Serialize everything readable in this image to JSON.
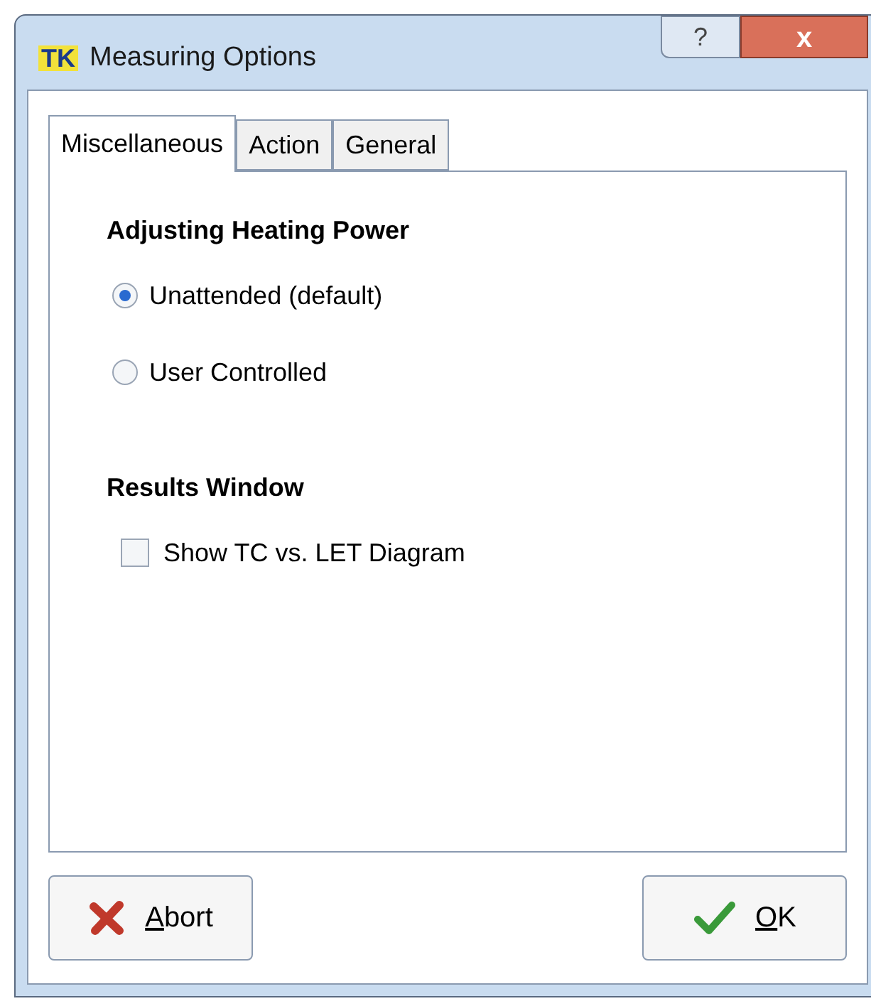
{
  "window": {
    "icon_text": "TK",
    "title": "Measuring Options",
    "help": "?",
    "close": "x"
  },
  "tabs": [
    {
      "label": "Miscellaneous",
      "selected": true
    },
    {
      "label": "Action",
      "selected": false
    },
    {
      "label": "General",
      "selected": false
    }
  ],
  "sections": [
    {
      "heading": "Adjusting  Heating Power",
      "items": [
        {
          "kind": "radio",
          "label": "Unattended (default)",
          "selected": true
        },
        {
          "kind": "radio",
          "label": "User Controlled",
          "selected": false
        }
      ]
    },
    {
      "heading": "Results Window",
      "items": [
        {
          "kind": "checkbox",
          "label": "Show TC vs. LET Diagram",
          "checked": false
        }
      ]
    }
  ],
  "buttons": [
    {
      "kind": "abort",
      "label": "Abort"
    },
    {
      "kind": "ok",
      "label": "OK"
    }
  ]
}
